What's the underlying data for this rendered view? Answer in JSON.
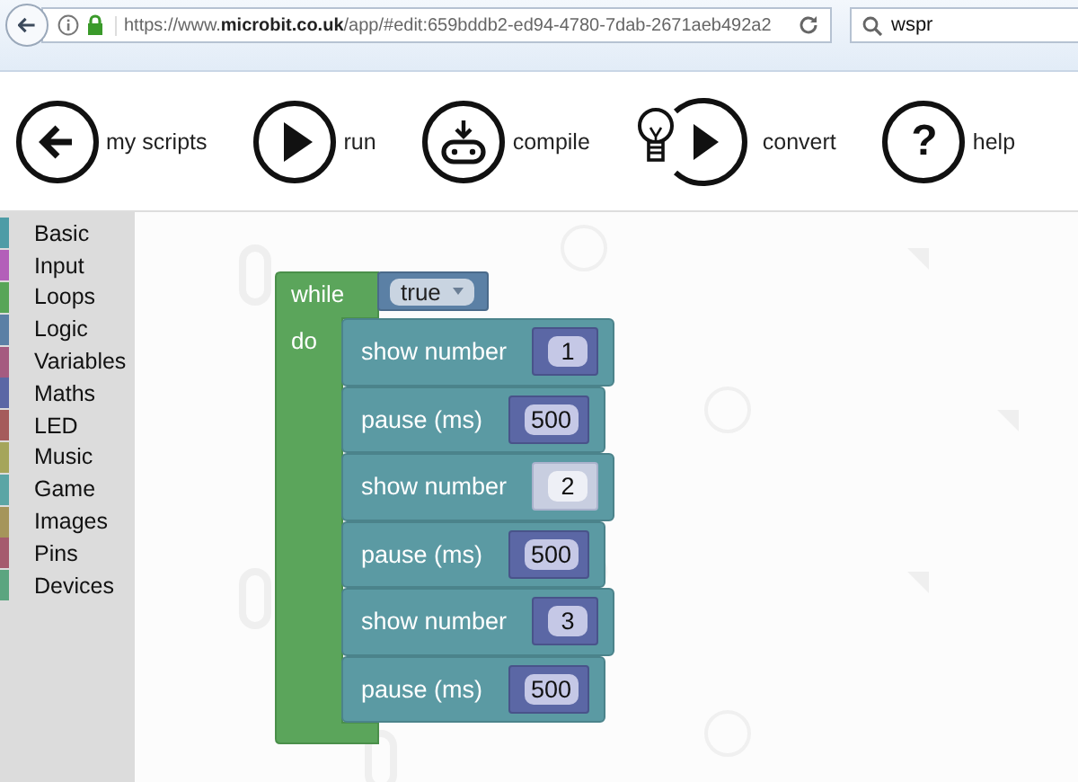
{
  "browser": {
    "url": "https://www.**microbit.co.uk**/app/#edit:659bddb2-ed94-4780-7dab-2671aeb492a2",
    "search": "wspr"
  },
  "toolbar": [
    {
      "kind": "back",
      "label": "my scripts"
    },
    {
      "kind": "run",
      "label": "run"
    },
    {
      "kind": "compile",
      "label": "compile"
    },
    {
      "kind": "convert",
      "label": "convert"
    },
    {
      "kind": "help",
      "label": "help",
      "icon_text": "?"
    }
  ],
  "categories": [
    {
      "label": "Basic",
      "color": "#4e9ca6"
    },
    {
      "label": "Input",
      "color": "#b35fb9"
    },
    {
      "label": "Loops",
      "color": "#58a558"
    },
    {
      "label": "Logic",
      "color": "#5b80a5"
    },
    {
      "label": "Variables",
      "color": "#a55b80"
    },
    {
      "label": "Maths",
      "color": "#5b67a5"
    },
    {
      "label": "LED",
      "color": "#a55b5b"
    },
    {
      "label": "Music",
      "color": "#a5a55b"
    },
    {
      "label": "Game",
      "color": "#5ba5a5"
    },
    {
      "label": "Images",
      "color": "#a5955b"
    },
    {
      "label": "Pins",
      "color": "#a55b6e"
    },
    {
      "label": "Devices",
      "color": "#5ba580"
    }
  ],
  "program": {
    "keyword": "while",
    "condition": "true",
    "body_label": "do",
    "statements": [
      {
        "label": "show number",
        "value": "1",
        "selected": false
      },
      {
        "label": "pause (ms)",
        "value": "500",
        "selected": false
      },
      {
        "label": "show number",
        "value": "2",
        "selected": true
      },
      {
        "label": "pause (ms)",
        "value": "500",
        "selected": false
      },
      {
        "label": "show number",
        "value": "3",
        "selected": false
      },
      {
        "label": "pause (ms)",
        "value": "500",
        "selected": false
      }
    ]
  }
}
